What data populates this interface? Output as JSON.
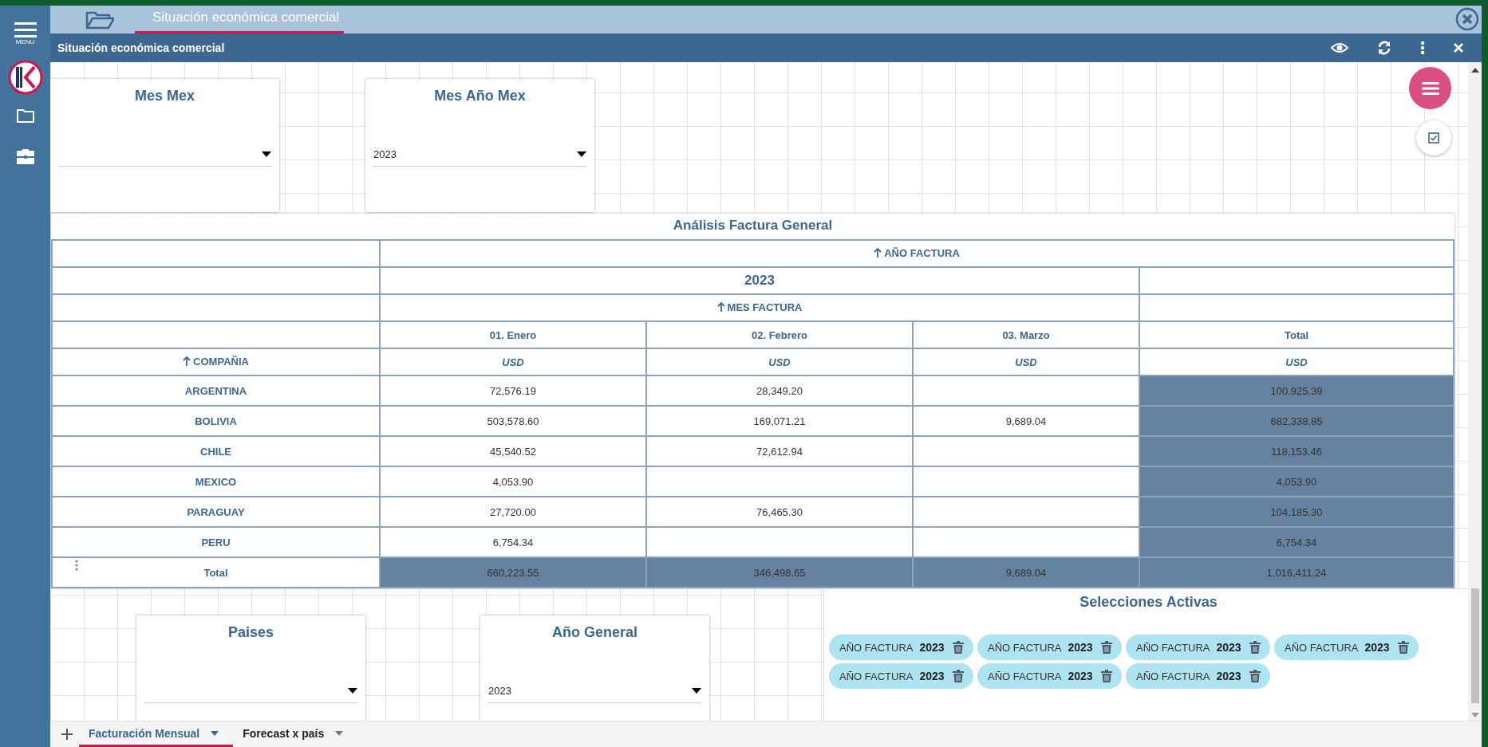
{
  "sidebar": {
    "menu_label": "MENU"
  },
  "tabs": [
    {
      "label": "Situación económica comercial",
      "selected": true
    }
  ],
  "panel": {
    "title": "Situación económica comercial"
  },
  "filters_top": [
    {
      "title": "Mes Mex"
    },
    {
      "title": "Mes Año Mex",
      "value": "2023"
    }
  ],
  "pivot": {
    "title": "Análisis Factura General",
    "column_field": "AÑO FACTURA",
    "year": "2023",
    "month_field": "MES FACTURA",
    "row_field": "COMPAÑIA",
    "columns": [
      {
        "label": "01. Enero",
        "unit": "USD",
        "kind": "month"
      },
      {
        "label": "02. Febrero",
        "unit": "USD",
        "kind": "month"
      },
      {
        "label": "03. Marzo",
        "unit": "USD",
        "kind": "month"
      },
      {
        "label": "Total",
        "unit": "USD",
        "kind": "total"
      }
    ],
    "rows": [
      {
        "label": "ARGENTINA",
        "kind": "data",
        "cells": [
          "72,576.19",
          "28,349.20",
          null,
          "100,925.39"
        ]
      },
      {
        "label": "BOLIVIA",
        "kind": "data",
        "cells": [
          "503,578.60",
          "169,071.21",
          "9,689.04",
          "682,338.85"
        ]
      },
      {
        "label": "CHILE",
        "kind": "data",
        "cells": [
          "45,540.52",
          "72,612.94",
          null,
          "118,153.46"
        ]
      },
      {
        "label": "MEXICO",
        "kind": "data",
        "cells": [
          "4,053.90",
          null,
          null,
          "4,053.90"
        ]
      },
      {
        "label": "PARAGUAY",
        "kind": "data",
        "cells": [
          "27,720.00",
          "76,465.30",
          null,
          "104,185.30"
        ]
      },
      {
        "label": "PERU",
        "kind": "data",
        "cells": [
          "6,754.34",
          null,
          null,
          "6,754.34"
        ]
      },
      {
        "label": "Total",
        "kind": "total",
        "cells": [
          "660,223.55",
          "346,498.65",
          "9,689.04",
          "1,016,411.24"
        ]
      }
    ]
  },
  "filters_bottom": [
    {
      "title": "Paises"
    },
    {
      "title": "Año General",
      "value": "2023"
    }
  ],
  "selections": {
    "title": "Selecciones Activas",
    "chips": [
      {
        "field": "AÑO FACTURA",
        "value": "2023"
      },
      {
        "field": "AÑO FACTURA",
        "value": "2023"
      },
      {
        "field": "AÑO FACTURA",
        "value": "2023"
      },
      {
        "field": "AÑO FACTURA",
        "value": "2023"
      },
      {
        "field": "AÑO FACTURA",
        "value": "2023"
      },
      {
        "field": "AÑO FACTURA",
        "value": "2023"
      },
      {
        "field": "AÑO FACTURA",
        "value": "2023"
      }
    ]
  },
  "sheet_tabs": [
    {
      "label": "Facturación Mensual",
      "selected": true
    },
    {
      "label": "Forecast x país",
      "selected": false
    }
  ]
}
